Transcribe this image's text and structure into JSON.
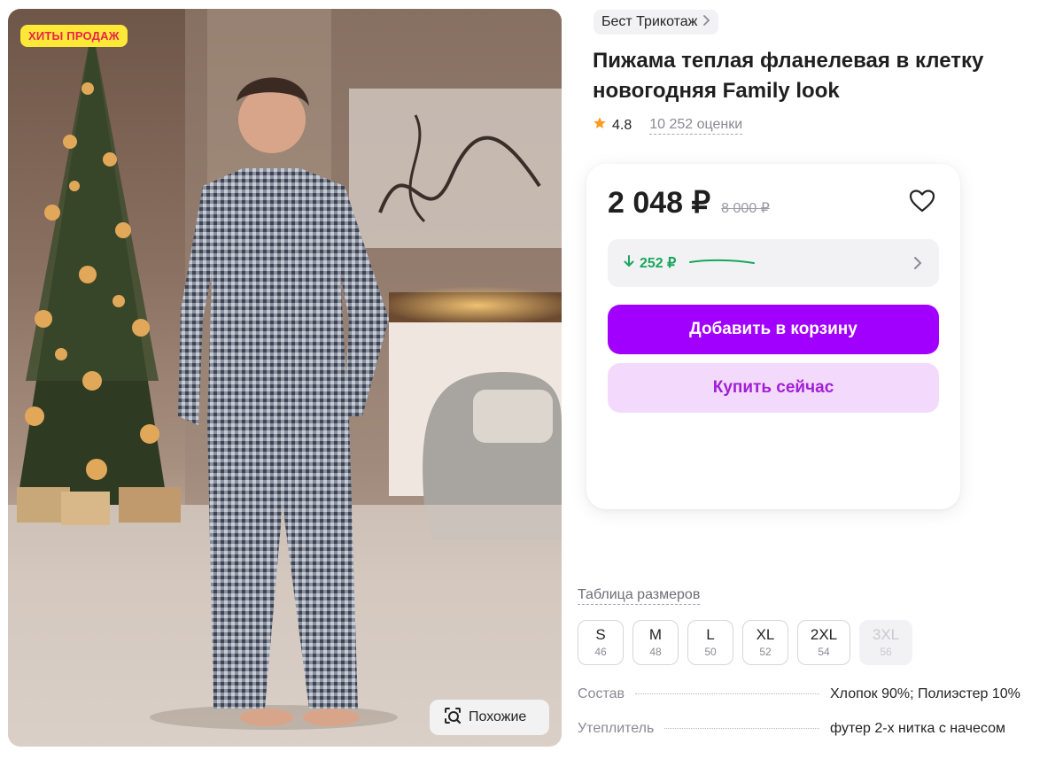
{
  "product_image": {
    "badge": "ХИТЫ ПРОДАЖ",
    "similar_button": "Похожие"
  },
  "brand": {
    "name": "Бест Трикотаж"
  },
  "product": {
    "title": "Пижама теплая фланелевая в клетку новогодняя Family look",
    "rating": "4.8",
    "reviews_count": "10 252 оценки"
  },
  "price_card": {
    "price": "2 048 ₽",
    "old_price": "8 000 ₽",
    "wallet_amount": "252 ₽",
    "add_to_cart": "Добавить в корзину",
    "buy_now": "Купить сейчас"
  },
  "sizes": {
    "table_link": "Таблица размеров",
    "items": [
      {
        "label": "S",
        "ru": "46"
      },
      {
        "label": "M",
        "ru": "48"
      },
      {
        "label": "L",
        "ru": "50"
      },
      {
        "label": "XL",
        "ru": "52"
      },
      {
        "label": "2XL",
        "ru": "54"
      },
      {
        "label": "3XL",
        "ru": "56"
      }
    ]
  },
  "specs": [
    {
      "key": "Состав",
      "value": "Хлопок 90%; Полиэстер 10%"
    },
    {
      "key": "Утеплитель",
      "value": "футер 2-х нитка с начесом"
    }
  ],
  "colors": {
    "accent": "#a100ff",
    "accent_light": "#f3dafd",
    "badge_bg": "#fde838",
    "badge_text": "#e8234a",
    "wallet_green": "#1aa65c",
    "star": "#ff9a1f"
  }
}
